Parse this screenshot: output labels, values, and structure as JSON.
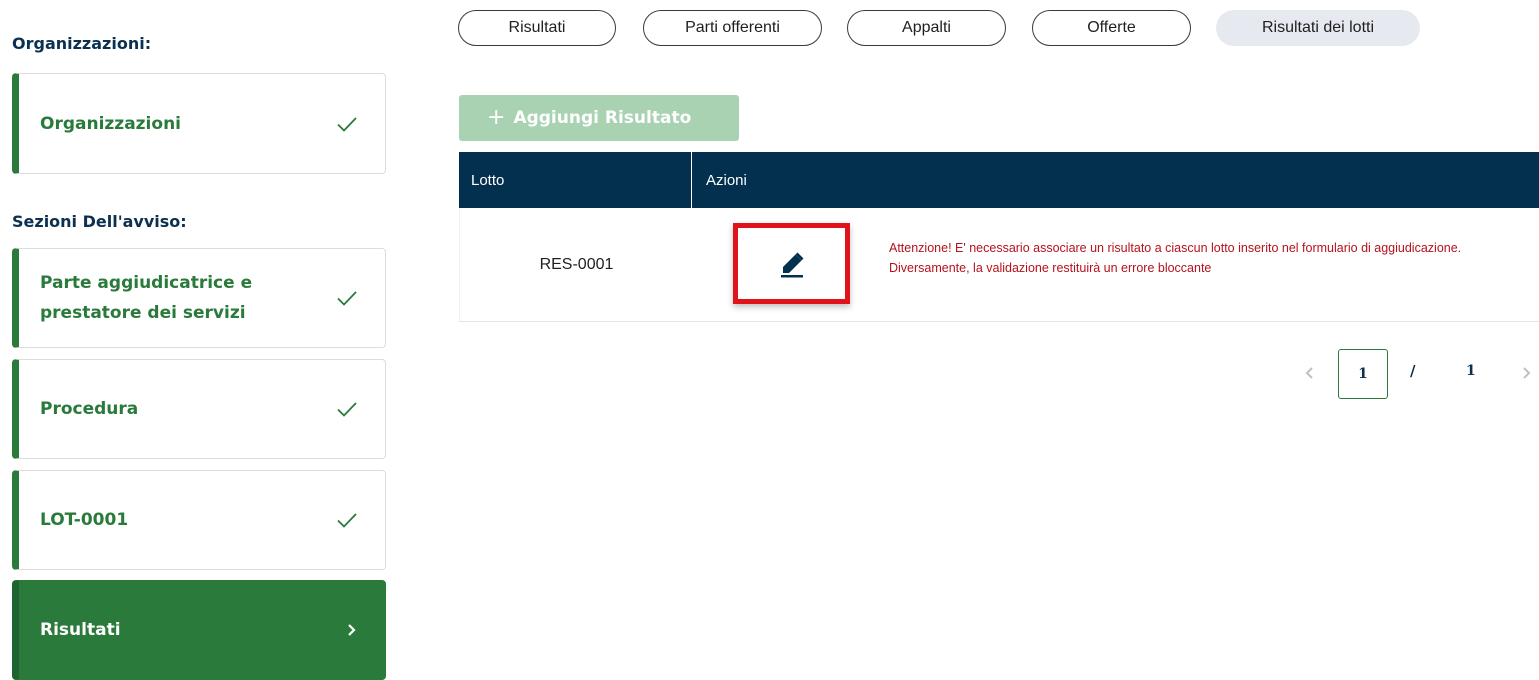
{
  "sidebar": {
    "organizations_heading": "Organizzazioni:",
    "organizations_items": [
      {
        "label": "Organizzazioni",
        "status": "check-icon"
      }
    ],
    "sections_heading": "Sezioni Dell'avviso:",
    "section_items": [
      {
        "label_line1": "Parte aggiudicatrice e",
        "label_line2": "prestatore dei servizi",
        "status": "check-icon"
      },
      {
        "label": "Procedura",
        "status": "check-icon"
      },
      {
        "label": "LOT-0001",
        "status": "check-icon"
      },
      {
        "label": "Risultati",
        "status": "chevron-right-icon",
        "active": true
      }
    ]
  },
  "tabs": [
    {
      "label": "Risultati",
      "selected": false
    },
    {
      "label": "Parti offerenti",
      "selected": false
    },
    {
      "label": "Appalti",
      "selected": false
    },
    {
      "label": "Offerte",
      "selected": false
    },
    {
      "label": "Risultati dei lotti",
      "selected": true
    }
  ],
  "add_button": {
    "icon": "plus-icon",
    "label": "Aggiungi Risultato",
    "disabled": true
  },
  "table": {
    "columns": [
      "Lotto",
      "Azioni"
    ],
    "rows": [
      {
        "lotto": "RES-0001",
        "action_icon": "pencil-icon",
        "warning": "Attenzione! E' necessario associare un risultato a ciascun lotto inserito nel formulario di aggiudicazione. Diversamente, la validazione restituirà un errore bloccante"
      }
    ]
  },
  "pagination": {
    "current_page": "1",
    "separator": "/",
    "total_pages": "1"
  },
  "colors": {
    "brand_green": "#2a7a3b",
    "header_navy": "#03304f",
    "heading_navy": "#0b3050",
    "warning_red": "#b5121b",
    "highlight_red": "#e0131b",
    "disabled_green": "#a8d2b1",
    "selected_tab_bg": "#e6e9f0"
  }
}
